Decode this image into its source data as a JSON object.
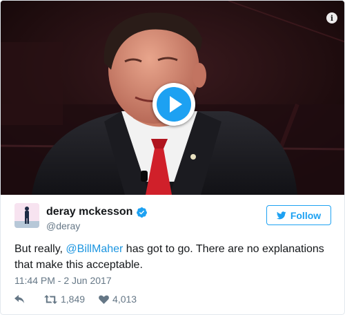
{
  "media": {
    "info_icon": "info-icon",
    "play_icon": "play-icon"
  },
  "author": {
    "name": "deray mckesson",
    "handle": "@deray",
    "verified": true
  },
  "follow_button": {
    "label": "Follow",
    "icon": "bird-icon"
  },
  "tweet": {
    "text_before": "But really, ",
    "mention": "@BillMaher",
    "text_after": " has got to go. There are no explanations that make this acceptable.",
    "timestamp": "11:44 PM - 2 Jun 2017"
  },
  "actions": {
    "reply_icon": "reply-icon",
    "retweet_count": "1,849",
    "like_count": "4,013"
  },
  "colors": {
    "accent": "#1da1f2",
    "link": "#1b95e0",
    "muted": "#657786",
    "text": "#14171a"
  }
}
